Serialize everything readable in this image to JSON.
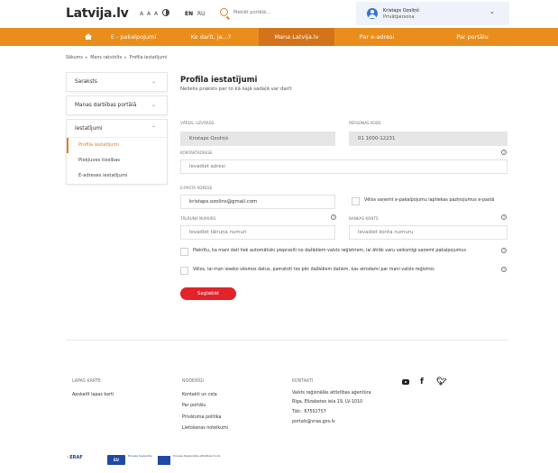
{
  "header": {
    "logo": "Latvija.lv",
    "font_size_label": "A A A",
    "languages": [
      "EN",
      "RU"
    ],
    "search_placeholder": "Meklēt portālā...",
    "user_name": "Kristaps Ozoliņš",
    "user_role": "Privātpersona"
  },
  "nav": {
    "items": [
      "E - pakalpojumi",
      "Ko darīt, ja...?",
      "Mana Latvija.lv",
      "Par e-adresi",
      "Par portālu"
    ],
    "active": "Mana Latvija.lv"
  },
  "breadcrumb": [
    "Sākums",
    "Mans rakstnīts",
    "Profila iestatījumi"
  ],
  "sidebar": {
    "sections": [
      {
        "label": "Saraksts"
      },
      {
        "label": "Manas darbības portālā"
      },
      {
        "label": "Iestatījumi",
        "items": [
          "Profila iestatījumi",
          "Pieķļuves tiesības",
          "E-adreses iestatījumi"
        ]
      }
    ],
    "active_item": "Profila iestatījumi"
  },
  "main": {
    "title": "Profila iestatījumi",
    "subtitle": "Nelielis praksts par to kā šajā sadaļā var darīt",
    "fields": {
      "name_label": "Vārds, uzvārds",
      "name_value": "Kristaps Ozoliņš",
      "pid_label": "Personas kods",
      "pid_value": "01 1000-12231",
      "address_label": "Kontaktadrese",
      "address_placeholder": "Ievadiet adresi",
      "email_label": "E-pasta adrese",
      "email_value": "kristaps.ozolins@gmail.com",
      "email_checkbox_label": "Vēlos saņemt e-pakalpojumu laptiekas paziņojumus e-pastā",
      "phone_label": "Tālruņa numurs",
      "phone_placeholder": "Ievadiet tālruņa numuri",
      "bank_label": "Bankas konts",
      "bank_placeholder": "Ievadiet konta numuru"
    },
    "checkbox_1": "Piekrītu, ka mani dati tiek automātiski pieprasīti no dažādiem valsts reģistriem, lai ātrāk varu veiksmīgi saņemt pakalpojumus",
    "checkbox_2": "Vēlos, lai man ieseko vēsmos datus, pamatoti tos pēc dažādiem datiem, kas atrodami par mani valsts reģistros",
    "save_label": "Saglabāt"
  },
  "footer": {
    "col1_title": "Lapas karte",
    "col1_links": [
      "Apskatīt lapas karti"
    ],
    "col2_title": "Noderīgi",
    "col2_links": [
      "Kontakti un ceļa",
      "Par portālu",
      "Privātuma politika",
      "Lietošanas noteikumi"
    ],
    "col3_title": "Kontakti",
    "col3_lines": [
      "Valsts reģionālās attīstības aģentūra",
      "Rīga, Elizabetes iela 19, LV-1010",
      "Tālr.: 67502757",
      "portals@vraa.gov.lv"
    ],
    "social": [
      "youtube-icon",
      "facebook-icon",
      "twitter-icon"
    ],
    "logos": {
      "erdf": "ERAF",
      "eu": "EU",
      "eu_text": "Eiropas Savienība",
      "eu2_text": "Eiropas Reģionālās attīstības fonds"
    }
  },
  "colors": {
    "accent": "#e98e1d",
    "nav_active": "#d4741a",
    "save_button": "#e3222b",
    "link_active": "#e67e22"
  }
}
